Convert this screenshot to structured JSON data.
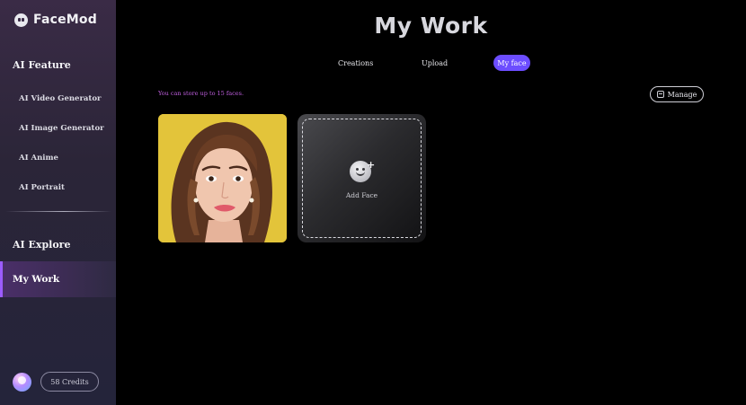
{
  "app": {
    "name": "FaceMod"
  },
  "sidebar": {
    "sections": {
      "ai_feature": "AI Feature",
      "ai_explore": "AI Explore",
      "my_work": "My Work"
    },
    "items": [
      {
        "label": "AI Video Generator"
      },
      {
        "label": "AI Image Generator"
      },
      {
        "label": "AI Anime"
      },
      {
        "label": "AI Portrait"
      }
    ],
    "credits": "58 Credits"
  },
  "main": {
    "title": "My Work",
    "tabs": [
      {
        "label": "Creations"
      },
      {
        "label": "Upload"
      },
      {
        "label": "My face",
        "active": true
      }
    ],
    "hint": "You can store up to 15 faces.",
    "manage_label": "Manage",
    "add_face_label": "Add Face"
  },
  "colors": {
    "accent": "#6c4dff",
    "active_border": "#9c5cff",
    "hint": "#c05fe0",
    "face_bg": "#e6c63a"
  }
}
